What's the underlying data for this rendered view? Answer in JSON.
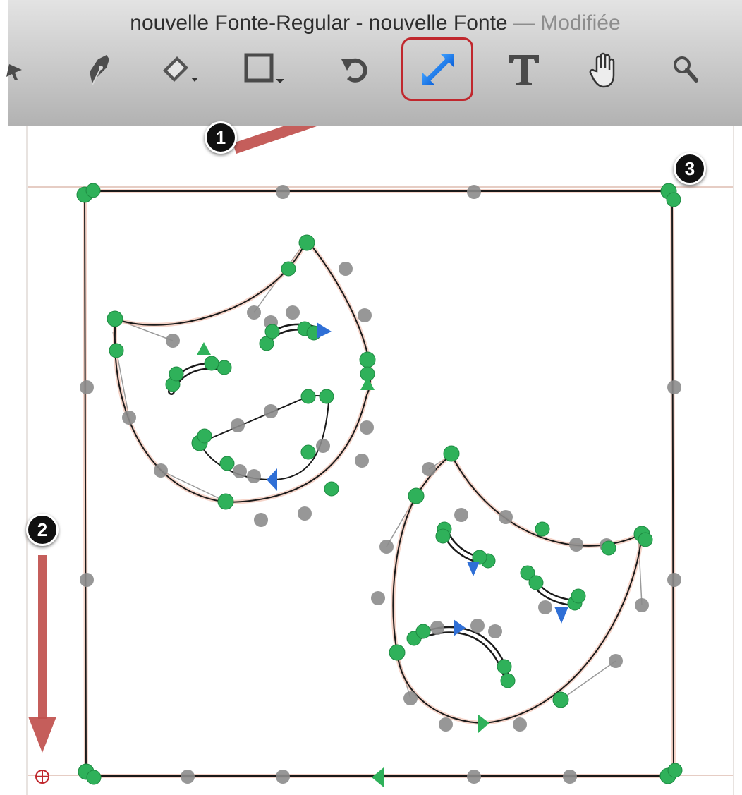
{
  "window": {
    "title_document": "nouvelle Fonte-Regular - nouvelle Fonte",
    "title_separator": " — ",
    "title_status": "Modifiée"
  },
  "toolbar": {
    "tools": [
      {
        "icon": "select-arrow-icon"
      },
      {
        "icon": "pen-nib-icon"
      },
      {
        "icon": "eraser-icon"
      },
      {
        "icon": "rectangle-tool-icon"
      },
      {
        "icon": "rotate-icon"
      },
      {
        "icon": "scale-icon",
        "active": true
      },
      {
        "icon": "text-tool-icon"
      },
      {
        "icon": "hand-icon"
      },
      {
        "icon": "magnifier-icon"
      }
    ],
    "highlight_color": "#c0272d"
  },
  "annotations": {
    "callout_1": "1",
    "callout_2": "2",
    "callout_3": "3",
    "arrow_color": "#c0504d"
  },
  "colors": {
    "on_curve_point": "#2fb15a",
    "off_curve_point": "#8c8c8c",
    "direction_marker": "#2f6fd6",
    "guide_line": "#e3c5bc",
    "outline": "#1a1a1a"
  }
}
